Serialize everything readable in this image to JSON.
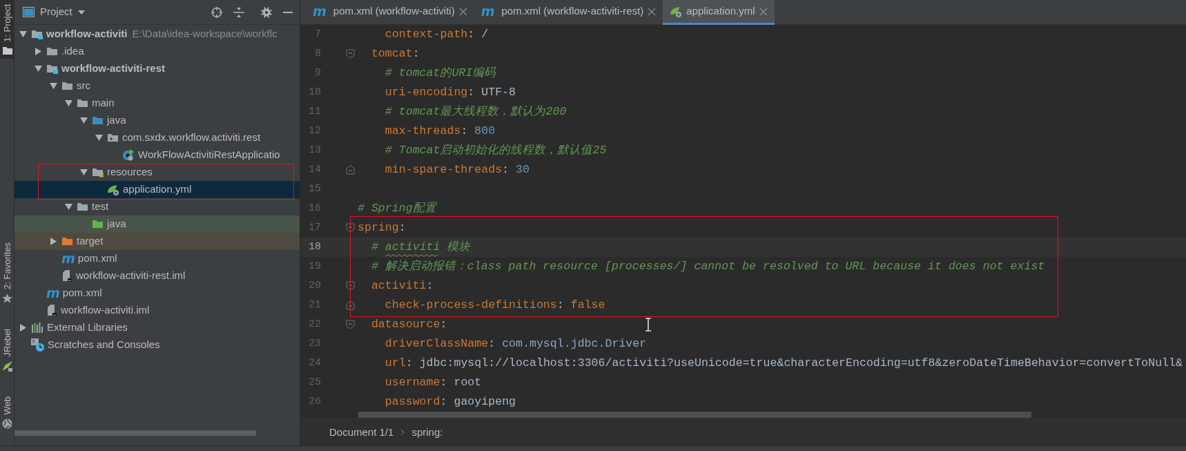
{
  "tool_stripe": {
    "top": [
      {
        "label": "1: Project",
        "kind": "project",
        "selected": true
      }
    ],
    "bottom": [
      {
        "label": "2: Favorites",
        "kind": "favorites",
        "selected": false
      },
      {
        "label": "JRebel",
        "kind": "jrebel",
        "selected": false
      },
      {
        "label": "Web",
        "kind": "web",
        "selected": false
      }
    ]
  },
  "project": {
    "title": "Project",
    "tree": [
      {
        "label": "workflow-activiti",
        "path": "E:\\Data\\idea-workspace\\workflc",
        "kind": "module",
        "bold": true,
        "expanded": true,
        "selected": false,
        "children": [
          {
            "label": ".idea",
            "kind": "folder",
            "expanded": false,
            "selected": false
          },
          {
            "label": "workflow-activiti-rest",
            "kind": "module",
            "bold": true,
            "expanded": true,
            "selected": false,
            "children": [
              {
                "label": "src",
                "kind": "folder",
                "expanded": true,
                "selected": false,
                "children": [
                  {
                    "label": "main",
                    "kind": "folder",
                    "expanded": true,
                    "selected": false,
                    "children": [
                      {
                        "label": "java",
                        "kind": "source",
                        "expanded": true,
                        "selected": false,
                        "children": [
                          {
                            "label": "com.sxdx.workflow.activiti.rest",
                            "kind": "package",
                            "expanded": true,
                            "selected": false,
                            "children": [
                              {
                                "label": "WorkFlowActivitiRestApplicatio",
                                "kind": "springclass",
                                "selected": false
                              }
                            ]
                          }
                        ]
                      },
                      {
                        "label": "resources",
                        "kind": "resources",
                        "expanded": true,
                        "selected": false,
                        "annotated": true,
                        "children": [
                          {
                            "label": "application.yml",
                            "kind": "springconfig",
                            "selected": true,
                            "annotated": true
                          }
                        ]
                      }
                    ]
                  },
                  {
                    "label": "test",
                    "kind": "folder",
                    "expanded": true,
                    "selected": false,
                    "children": [
                      {
                        "label": "java",
                        "kind": "test",
                        "selected": false
                      }
                    ]
                  }
                ]
              },
              {
                "label": "target",
                "kind": "excluded",
                "expanded": false,
                "selected": false
              },
              {
                "label": "pom.xml",
                "kind": "maven",
                "icon_letter": "m",
                "selected": false
              },
              {
                "label": "workflow-activiti-rest.iml",
                "kind": "iml",
                "selected": false
              }
            ]
          },
          {
            "label": "pom.xml",
            "kind": "maven",
            "icon_letter": "m",
            "selected": false
          },
          {
            "label": "workflow-activiti.iml",
            "kind": "iml",
            "selected": false
          }
        ]
      },
      {
        "label": "External Libraries",
        "kind": "libraries",
        "expanded": false,
        "selected": false
      },
      {
        "label": "Scratches and Consoles",
        "kind": "scratches",
        "selected": false
      }
    ]
  },
  "editor": {
    "tabs": [
      {
        "label": "pom.xml (workflow-activiti)",
        "kind": "maven",
        "icon_letter": "m",
        "selected": false
      },
      {
        "label": "pom.xml (workflow-activiti-rest)",
        "kind": "maven",
        "icon_letter": "m",
        "selected": false
      },
      {
        "label": "application.yml",
        "kind": "springconfig",
        "selected": true
      }
    ],
    "lines": [
      {
        "number": "7",
        "tokens": [
          {
            "kind": "key",
            "text": "    context-path"
          },
          {
            "kind": "punct",
            "text": ": "
          },
          {
            "kind": "plain",
            "text": "/"
          }
        ]
      },
      {
        "number": "8",
        "fold_start": true,
        "tokens": [
          {
            "kind": "key",
            "text": "  tomcat"
          },
          {
            "kind": "punct",
            "text": ":"
          }
        ]
      },
      {
        "number": "9",
        "tokens": [
          {
            "kind": "comment",
            "text": "    # tomcat的URI编码"
          }
        ]
      },
      {
        "number": "10",
        "tokens": [
          {
            "kind": "key",
            "text": "    uri-encoding"
          },
          {
            "kind": "punct",
            "text": ": "
          },
          {
            "kind": "plain",
            "text": "UTF-8"
          }
        ]
      },
      {
        "number": "11",
        "tokens": [
          {
            "kind": "comment",
            "text": "    # tomcat最大线程数，默认为200"
          }
        ]
      },
      {
        "number": "12",
        "tokens": [
          {
            "kind": "key",
            "text": "    max-threads"
          },
          {
            "kind": "punct",
            "text": ": "
          },
          {
            "kind": "number",
            "text": "800"
          }
        ]
      },
      {
        "number": "13",
        "tokens": [
          {
            "kind": "comment",
            "text": "    # Tomcat启动初始化的线程数，默认值25"
          }
        ]
      },
      {
        "number": "14",
        "fold_end": true,
        "tokens": [
          {
            "kind": "key",
            "text": "    min-spare-threads"
          },
          {
            "kind": "punct",
            "text": ": "
          },
          {
            "kind": "number",
            "text": "30"
          }
        ]
      },
      {
        "number": "15"
      },
      {
        "number": "16",
        "tokens": [
          {
            "kind": "comment",
            "text": "# Spring配置"
          }
        ]
      },
      {
        "number": "17",
        "fold_start": true,
        "annotated": true,
        "tokens": [
          {
            "kind": "key",
            "text": "spring"
          },
          {
            "kind": "punct",
            "text": ":"
          }
        ]
      },
      {
        "number": "18",
        "current": true,
        "annotated": true,
        "tokens": [
          {
            "kind": "comment",
            "text": "  # "
          },
          {
            "kind": "comment",
            "text": "activiti",
            "typo": true
          },
          {
            "kind": "comment",
            "text": " 模块"
          }
        ]
      },
      {
        "number": "19",
        "annotated": true,
        "tokens": [
          {
            "kind": "comment",
            "text": "  # 解决启动报错：class path resource [processes/] cannot be resolved to URL because it does not exist"
          }
        ]
      },
      {
        "number": "20",
        "fold_start": true,
        "annotated": true,
        "tokens": [
          {
            "kind": "key",
            "text": "  activiti"
          },
          {
            "kind": "punct",
            "text": ":"
          }
        ]
      },
      {
        "number": "21",
        "fold_end": true,
        "annotated": true,
        "tokens": [
          {
            "kind": "key",
            "text": "    check-process-definitions"
          },
          {
            "kind": "punct",
            "text": ": "
          },
          {
            "kind": "keyword",
            "text": "false"
          }
        ]
      },
      {
        "number": "22",
        "fold_start": true,
        "tokens": [
          {
            "kind": "key",
            "text": "  datasource"
          },
          {
            "kind": "punct",
            "text": ":"
          }
        ]
      },
      {
        "number": "23",
        "tokens": [
          {
            "kind": "key",
            "text": "    driverClassName"
          },
          {
            "kind": "punct",
            "text": ": "
          },
          {
            "kind": "class",
            "text": "com.mysql.jdbc.Driver"
          }
        ]
      },
      {
        "number": "24",
        "tokens": [
          {
            "kind": "key",
            "text": "    url"
          },
          {
            "kind": "punct",
            "text": ": "
          },
          {
            "kind": "plain",
            "text": "jdbc:mysql://localhost:3306/activiti?useUnicode=true&characterEncoding=utf8&zeroDateTimeBehavior=convertToNull&"
          }
        ]
      },
      {
        "number": "25",
        "tokens": [
          {
            "kind": "key",
            "text": "    username"
          },
          {
            "kind": "punct",
            "text": ": "
          },
          {
            "kind": "plain",
            "text": "root"
          }
        ]
      },
      {
        "number": "26",
        "tokens": [
          {
            "kind": "key",
            "text": "    password"
          },
          {
            "kind": "punct",
            "text": ": "
          },
          {
            "kind": "plain",
            "text": "gaoyipeng"
          }
        ]
      }
    ],
    "breadcrumbs": [
      "Document 1/1",
      "spring:"
    ]
  }
}
